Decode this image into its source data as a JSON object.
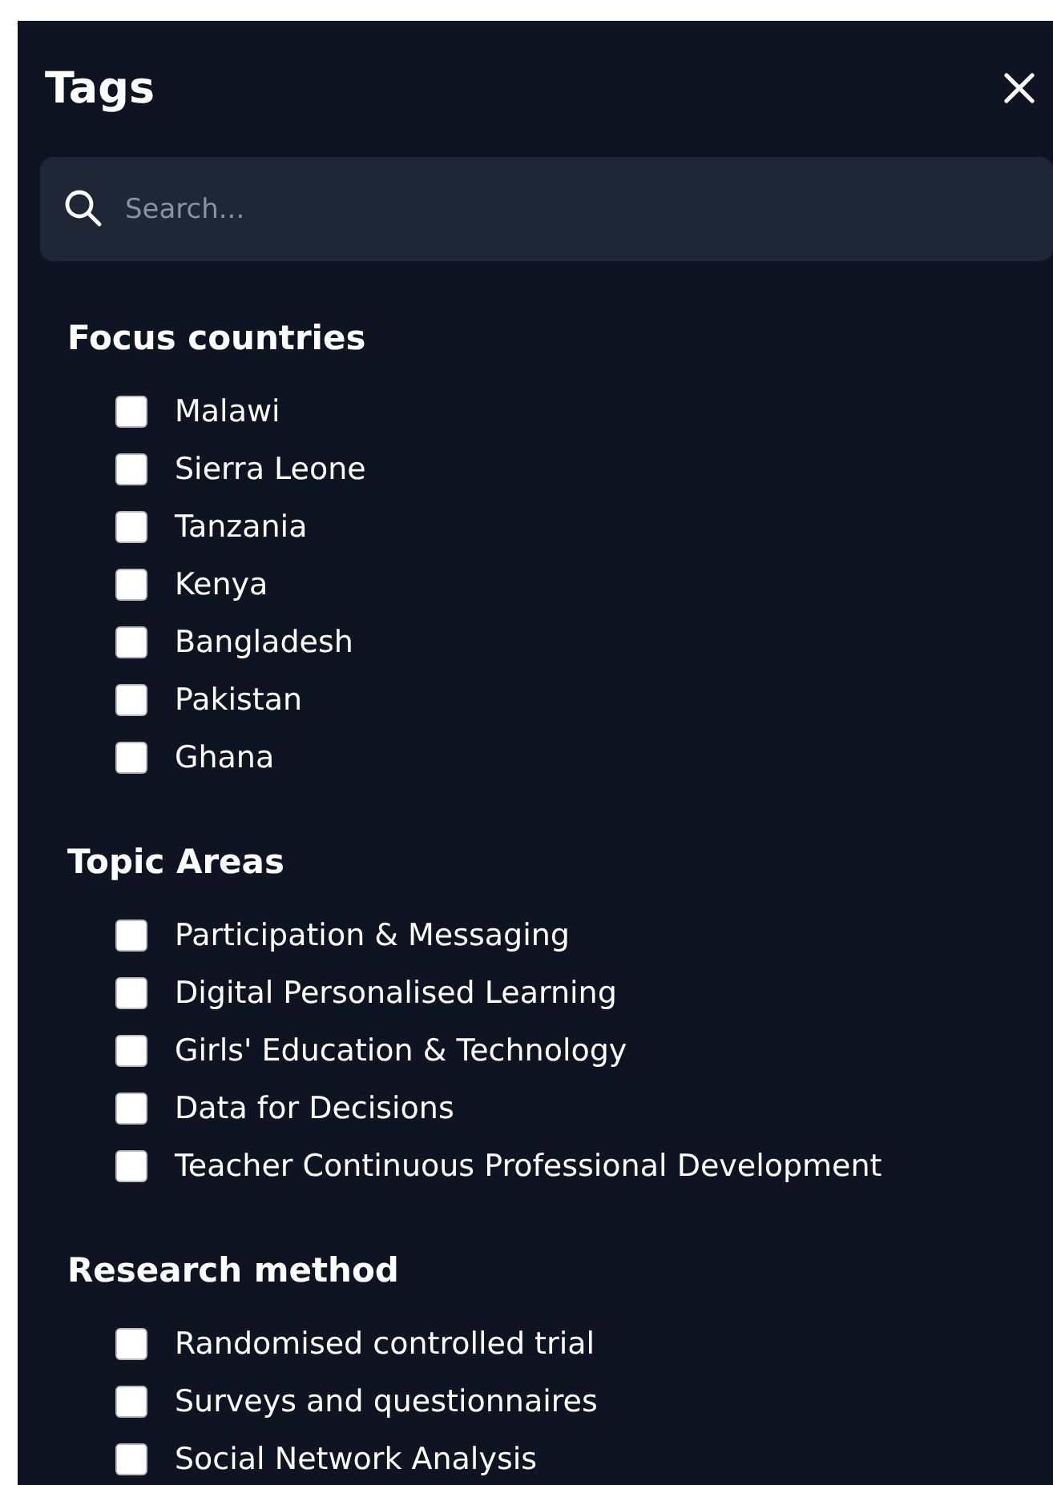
{
  "panel": {
    "title": "Tags"
  },
  "search": {
    "placeholder": "Search..."
  },
  "sections": [
    {
      "heading": "Focus countries",
      "items": [
        {
          "label": "Malawi",
          "checked": false
        },
        {
          "label": "Sierra Leone",
          "checked": false
        },
        {
          "label": "Tanzania",
          "checked": false
        },
        {
          "label": "Kenya",
          "checked": false
        },
        {
          "label": "Bangladesh",
          "checked": false
        },
        {
          "label": "Pakistan",
          "checked": false
        },
        {
          "label": "Ghana",
          "checked": false
        }
      ]
    },
    {
      "heading": "Topic Areas",
      "items": [
        {
          "label": "Participation & Messaging",
          "checked": false
        },
        {
          "label": "Digital Personalised Learning",
          "checked": false
        },
        {
          "label": "Girls' Education & Technology",
          "checked": false
        },
        {
          "label": "Data for Decisions",
          "checked": false
        },
        {
          "label": "Teacher Continuous Professional Development",
          "checked": false
        }
      ]
    },
    {
      "heading": "Research method",
      "items": [
        {
          "label": "Randomised controlled trial",
          "checked": false
        },
        {
          "label": "Surveys and questionnaires",
          "checked": false
        },
        {
          "label": "Social Network Analysis",
          "checked": false
        }
      ]
    }
  ]
}
